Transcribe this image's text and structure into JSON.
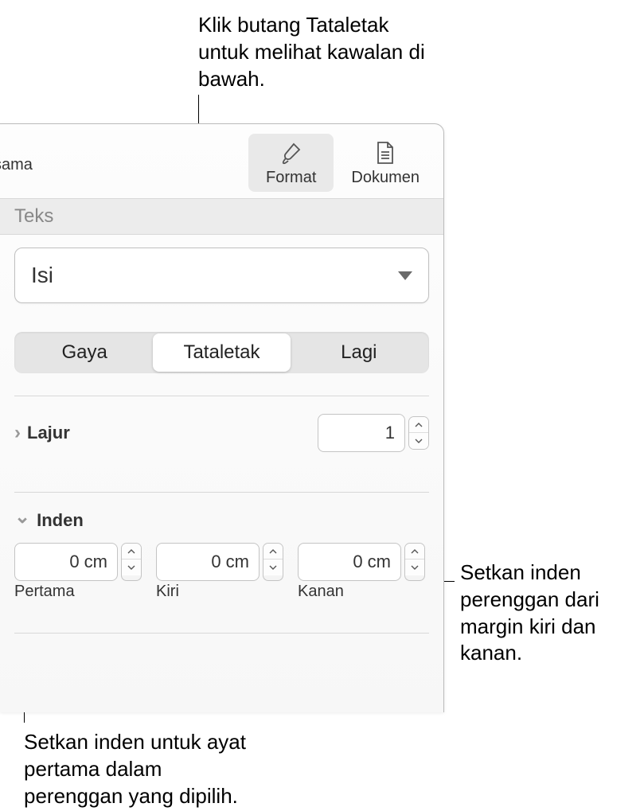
{
  "callouts": {
    "top": "Klik butang Tataletak untuk melihat kawalan di bawah.",
    "right": "Setkan inden perenggan dari margin kiri dan kanan.",
    "bottom": "Setkan inden untuk ayat pertama dalam perenggan yang dipilih."
  },
  "toolbar": {
    "left_partial": "sama",
    "format": "Format",
    "dokumen": "Dokumen"
  },
  "section": {
    "teks": "Teks"
  },
  "style_dropdown": {
    "value": "Isi"
  },
  "tabs": {
    "gaya": "Gaya",
    "tataletak": "Tataletak",
    "lagi": "Lagi"
  },
  "lajur": {
    "label": "Lajur",
    "value": "1"
  },
  "inden": {
    "label": "Inden",
    "pertama": {
      "value": "0 cm",
      "label": "Pertama"
    },
    "kiri": {
      "value": "0 cm",
      "label": "Kiri"
    },
    "kanan": {
      "value": "0 cm",
      "label": "Kanan"
    }
  }
}
